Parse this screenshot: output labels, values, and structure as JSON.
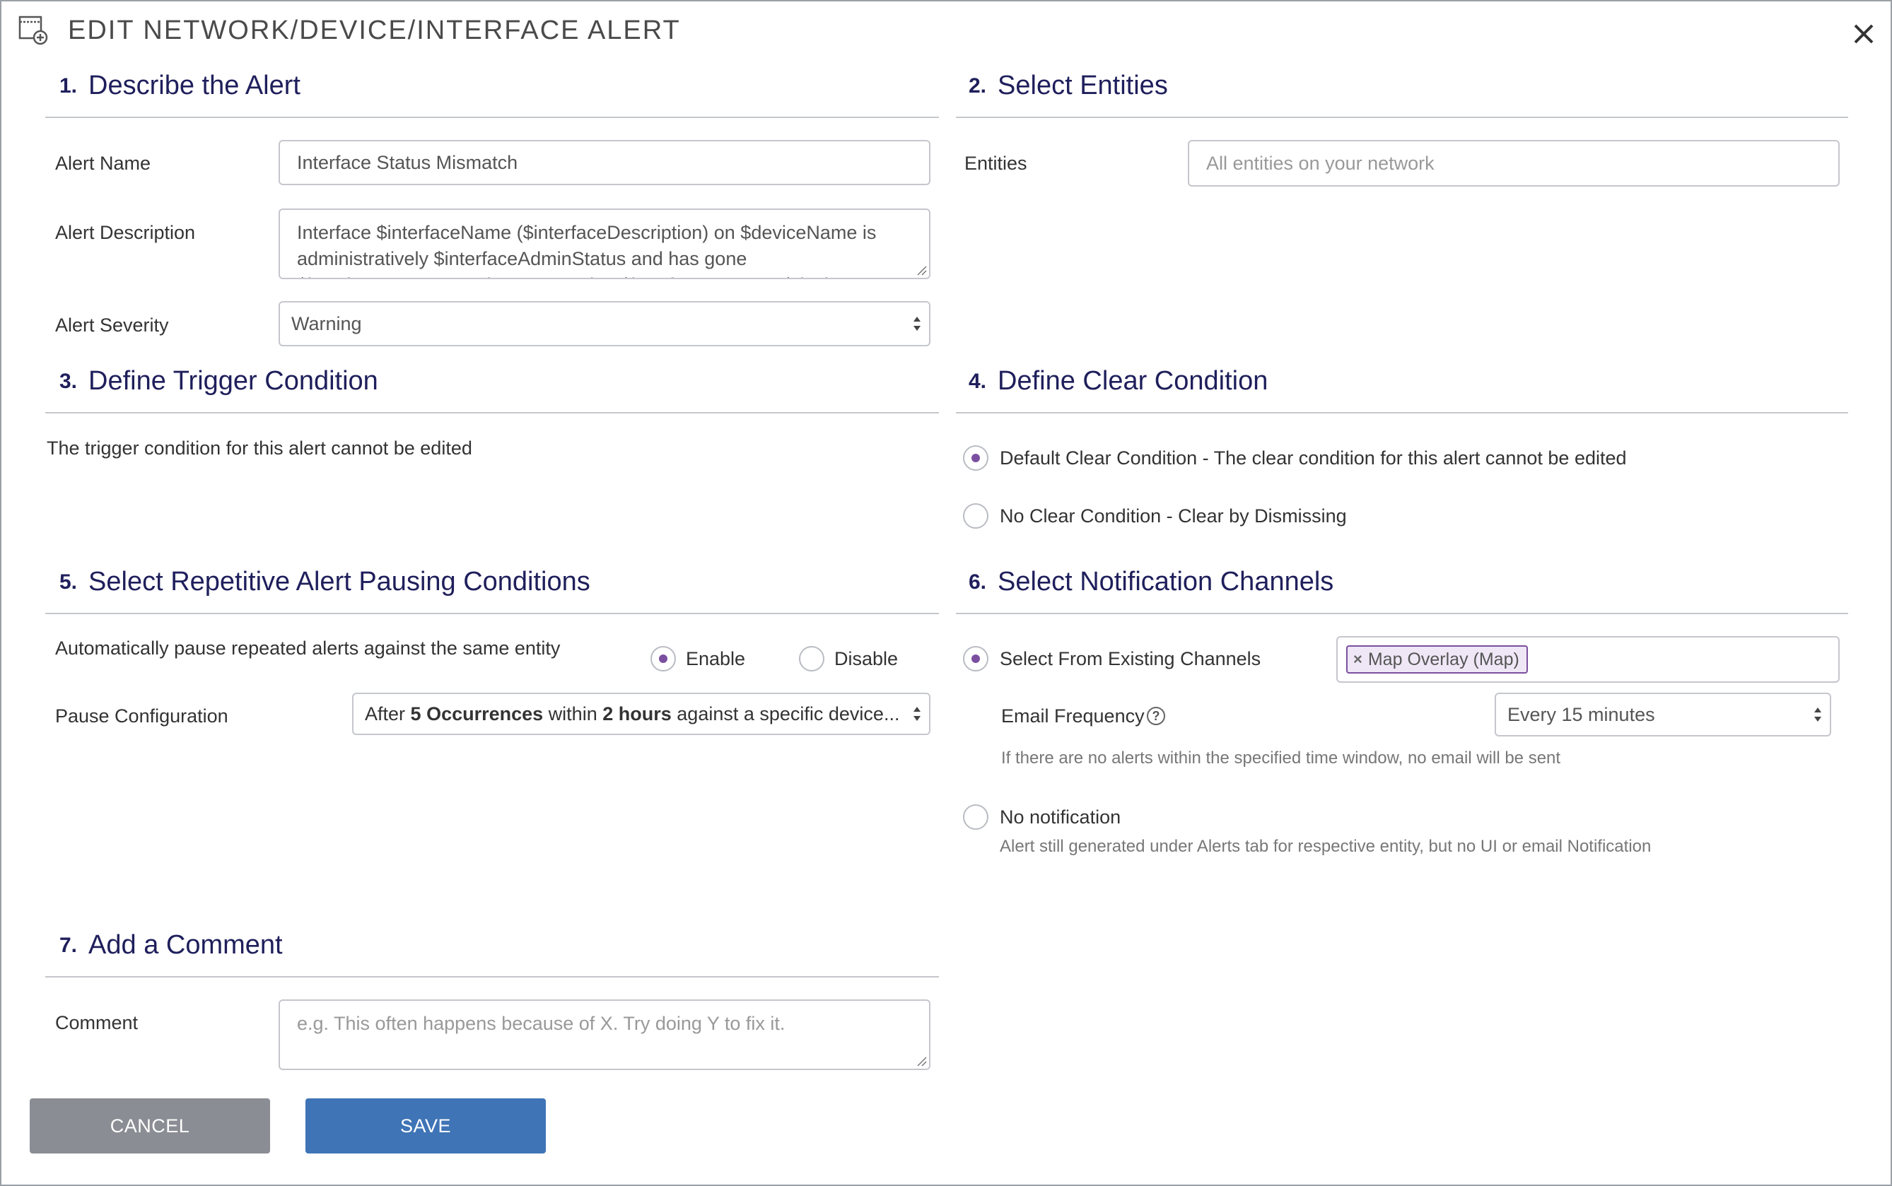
{
  "dialog": {
    "title": "EDIT NETWORK/DEVICE/INTERFACE ALERT",
    "title_icon": "add-window-icon",
    "close_icon": "close-icon"
  },
  "sections": {
    "s1": {
      "num": "1.",
      "title": "Describe the Alert"
    },
    "s2": {
      "num": "2.",
      "title": "Select Entities"
    },
    "s3": {
      "num": "3.",
      "title": "Define Trigger Condition"
    },
    "s4": {
      "num": "4.",
      "title": "Define Clear Condition"
    },
    "s5": {
      "num": "5.",
      "title": "Select Repetitive Alert Pausing Conditions"
    },
    "s6": {
      "num": "6.",
      "title": "Select Notification Channels"
    },
    "s7": {
      "num": "7.",
      "title": "Add a Comment"
    }
  },
  "describe": {
    "alert_name_label": "Alert Name",
    "alert_name_value": "Interface Status Mismatch",
    "alert_description_label": "Alert Description",
    "alert_description_value": "Interface $interfaceName ($interfaceDescription) on $deviceName is administratively $interfaceAdminStatus and has gone $interfaceOpStatus. It is connected to $interfaceCNvs on $deviceCNvs",
    "alert_severity_label": "Alert Severity",
    "alert_severity_value": "Warning"
  },
  "entities": {
    "label": "Entities",
    "placeholder": "All entities on your network"
  },
  "trigger": {
    "text": "The trigger condition for this alert cannot be edited"
  },
  "clear": {
    "options": [
      {
        "label": "Default Clear Condition - The clear condition for this alert cannot be edited",
        "checked": true
      },
      {
        "label": "No Clear Condition - Clear by Dismissing",
        "checked": false
      }
    ]
  },
  "pausing": {
    "auto_pause_label": "Automatically pause repeated alerts against the same entity",
    "enable_label": "Enable",
    "enable_checked": true,
    "disable_label": "Disable",
    "disable_checked": false,
    "pause_config_label": "Pause Configuration",
    "pause_config_value": {
      "after": "After",
      "occurrences": "5 Occurrences",
      "within": "within",
      "hours": "2 hours",
      "rest": "against a specific device..."
    }
  },
  "notification": {
    "existing_label": "Select From Existing Channels",
    "existing_checked": true,
    "channel_chip": "Map Overlay (Map)",
    "chip_remove": "×",
    "email_frequency_label": "Email Frequency",
    "help_glyph": "?",
    "email_frequency_value": "Every 15 minutes",
    "email_hint": "If there are no alerts within the specified time window, no email will be sent",
    "no_notification_label": "No notification",
    "no_notification_checked": false,
    "no_notification_hint": "Alert still generated under Alerts tab for respective entity, but no UI or email Notification"
  },
  "comment": {
    "label": "Comment",
    "placeholder": "e.g. This often happens because of X. Try doing Y to fix it."
  },
  "buttons": {
    "cancel": "CANCEL",
    "save": "SAVE"
  },
  "colors": {
    "heading": "#1f1f5c",
    "radio_checked": "#7b4fa0",
    "save_button": "#3f74b6",
    "cancel_button": "#8a8d93"
  }
}
